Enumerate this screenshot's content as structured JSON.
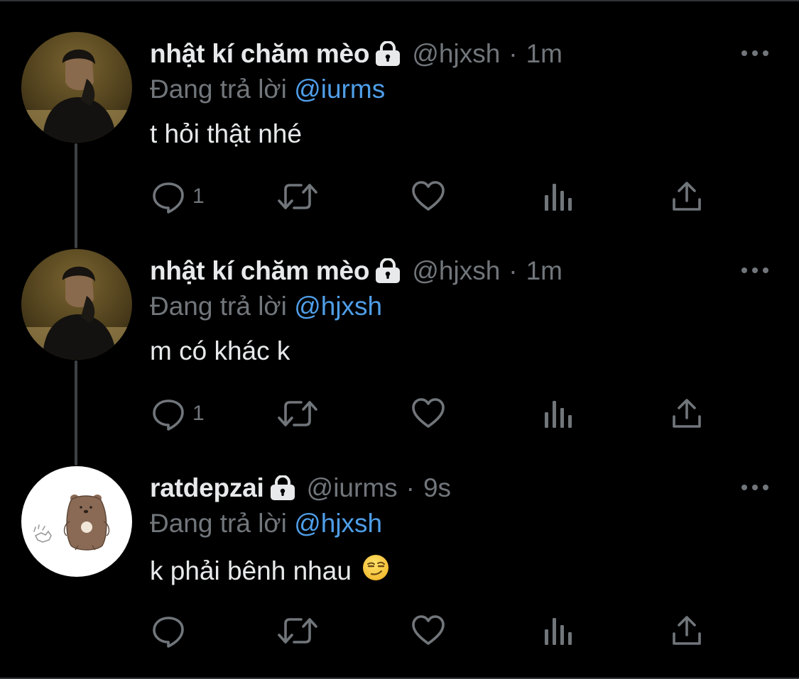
{
  "tweets": [
    {
      "display_name": "nhật kí chăm mèo",
      "handle": "@hjxsh",
      "separator": "·",
      "time": "1m",
      "replying_prefix": "Đang trả lời",
      "replying_to": "@iurms",
      "text": "t hỏi thật nhé",
      "reply_count": "1",
      "protected": true
    },
    {
      "display_name": "nhật kí chăm mèo",
      "handle": "@hjxsh",
      "separator": "·",
      "time": "1m",
      "replying_prefix": "Đang trả lời",
      "replying_to": "@hjxsh",
      "text": "m có khác k",
      "reply_count": "1",
      "protected": true
    },
    {
      "display_name": "ratdepzai",
      "handle": "@iurms",
      "separator": "·",
      "time": "9s",
      "replying_prefix": "Đang trả lời",
      "replying_to": "@hjxsh",
      "text": "k phải bênh nhau",
      "emoji": "smirking-face",
      "reply_count": "",
      "protected": true
    }
  ],
  "icons": {
    "reply": "reply-icon",
    "retweet": "retweet-icon",
    "like": "heart-icon",
    "views": "analytics-icon",
    "share": "share-icon",
    "more": "more-icon",
    "lock": "lock-icon"
  },
  "colors": {
    "background": "#000000",
    "primary_text": "#e7e9ea",
    "secondary_text": "#71767b",
    "mention": "#4f9ee8",
    "thread_line": "#3e4144"
  }
}
